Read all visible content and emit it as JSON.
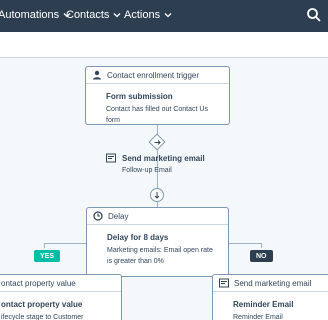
{
  "nav": {
    "items": [
      {
        "label": "Automations"
      },
      {
        "label": "Contacts"
      },
      {
        "label": "Actions"
      }
    ]
  },
  "trigger": {
    "header": "Contact enrollment trigger",
    "title": "Form submission",
    "text": "Contact has filled out Contact Us form"
  },
  "email_action": {
    "title": "Send marketing email",
    "email": "Follow-up Email"
  },
  "delay": {
    "header": "Delay",
    "title": "Delay for 8 days",
    "line1_prefix": "Marketing emails:",
    "line1_suffix": "Email open rate",
    "line2": "is greater than 0%"
  },
  "branches": {
    "yes_label": "YES",
    "no_label": "NO",
    "yes_color": "#00bda5",
    "no_color": "#2d3e50"
  },
  "left_card": {
    "header": "ontact property value",
    "title": "ontact property value",
    "text": "ifecycle stage to Customer"
  },
  "right_card": {
    "header": "Send marketing email",
    "title": "Reminder Email",
    "text": "Reminder Email"
  },
  "icons": {
    "trigger": "person-icon",
    "email": "email-icon",
    "delay": "clock-icon",
    "add": "arrow-right-icon",
    "search": "search-icon"
  }
}
